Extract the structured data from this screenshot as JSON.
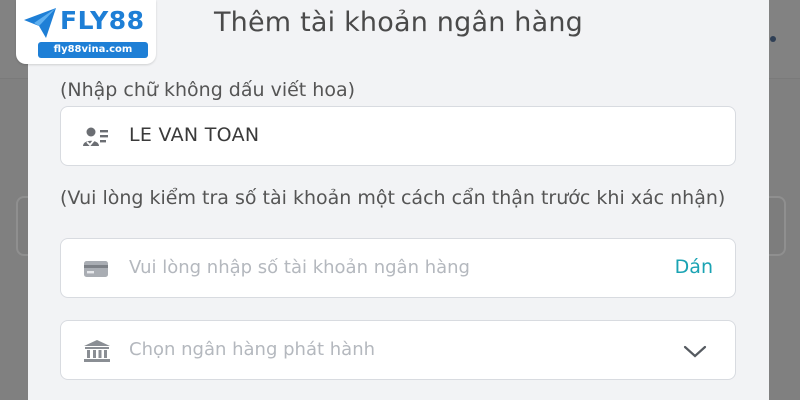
{
  "brand": {
    "name": "FLY88",
    "domain": "fly88vina.com",
    "color": "#1e7fd6"
  },
  "modal": {
    "title": "Thêm tài khoản ngân hàng"
  },
  "form": {
    "name_hint": "(Nhập chữ không dấu viết hoa)",
    "account_name_value": "LE VAN TOAN",
    "account_name_icon": "id-card-icon",
    "account_number_hint": "(Vui lòng kiểm tra số tài khoản một cách cẩn thận trước khi xác nhận)",
    "account_number_placeholder": "Vui lòng nhập số tài khoản ngân hàng",
    "account_number_icon": "credit-card-icon",
    "paste_label": "Dán",
    "paste_color": "#1aa3b3",
    "bank_select_placeholder": "Chọn ngân hàng phát hành",
    "bank_select_icon": "bank-icon"
  }
}
